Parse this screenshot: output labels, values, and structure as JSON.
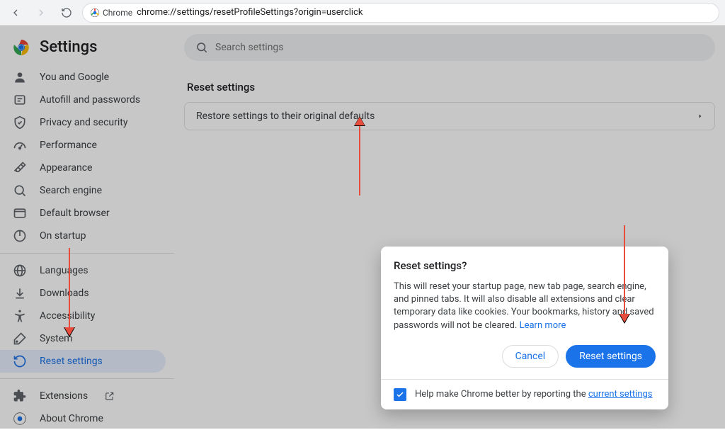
{
  "browser": {
    "chip_label": "Chrome",
    "url": "chrome://settings/resetProfileSettings?origin=userclick"
  },
  "header": {
    "title": "Settings"
  },
  "search": {
    "placeholder": "Search settings"
  },
  "sidebar": {
    "group_a": [
      {
        "icon": "person-icon",
        "label": "You and Google"
      },
      {
        "icon": "autofill-icon",
        "label": "Autofill and passwords"
      },
      {
        "icon": "privacy-icon",
        "label": "Privacy and security"
      },
      {
        "icon": "performance-icon",
        "label": "Performance"
      },
      {
        "icon": "appearance-icon",
        "label": "Appearance"
      },
      {
        "icon": "search-icon",
        "label": "Search engine"
      },
      {
        "icon": "default-browser-icon",
        "label": "Default browser"
      },
      {
        "icon": "startup-icon",
        "label": "On startup"
      }
    ],
    "group_b": [
      {
        "icon": "languages-icon",
        "label": "Languages"
      },
      {
        "icon": "downloads-icon",
        "label": "Downloads"
      },
      {
        "icon": "accessibility-icon",
        "label": "Accessibility"
      },
      {
        "icon": "system-icon",
        "label": "System"
      },
      {
        "icon": "reset-icon",
        "label": "Reset settings",
        "active": true
      }
    ],
    "group_c": [
      {
        "icon": "extensions-icon",
        "label": "Extensions",
        "external": true
      },
      {
        "icon": "about-icon",
        "label": "About Chrome"
      }
    ]
  },
  "main": {
    "section_title": "Reset settings",
    "row_label": "Restore settings to their original defaults"
  },
  "dialog": {
    "title": "Reset settings?",
    "body": "This will reset your startup page, new tab page, search engine, and pinned tabs. It will also disable all extensions and clear temporary data like cookies. Your bookmarks, history and saved passwords will not be cleared.",
    "learn_more": "Learn more",
    "cancel": "Cancel",
    "confirm": "Reset settings",
    "footer_text": "Help make Chrome better by reporting the ",
    "footer_link": "current settings"
  }
}
